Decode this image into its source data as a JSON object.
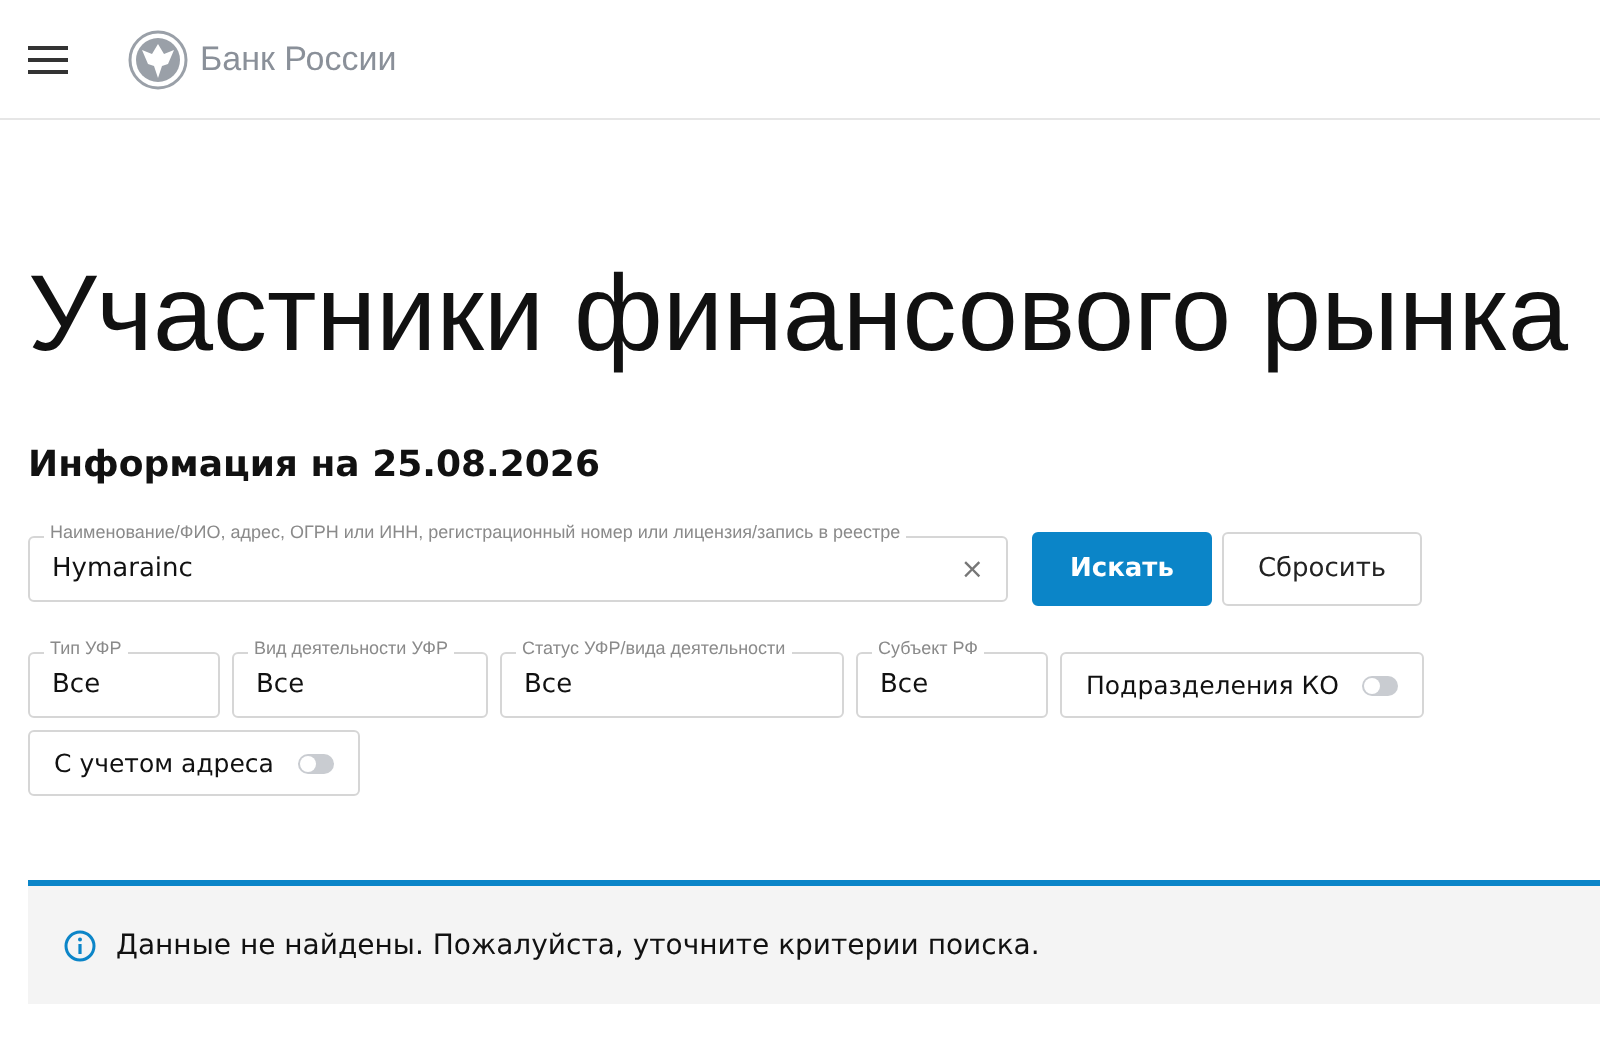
{
  "header": {
    "logo_text": "Банк России"
  },
  "title": "Участники финансового рынка",
  "subtitle": "Информация на 25.08.2026",
  "search": {
    "label": "Наименование/ФИО, адрес, ОГРН или ИНН, регистрационный номер или лицензия/запись в реестре",
    "value": "Hymarainc",
    "clear": "×"
  },
  "buttons": [
    {
      "label": "Искать",
      "kind": "primary"
    },
    {
      "label": "Сбросить",
      "kind": "secondary"
    }
  ],
  "filters": [
    {
      "kind": "select",
      "label": "Тип УФР",
      "value": "Все"
    },
    {
      "kind": "select",
      "label": "Вид деятельности УФР",
      "value": "Все"
    },
    {
      "kind": "select",
      "label": "Статус УФР/вида деятельности",
      "value": "Все"
    },
    {
      "kind": "select",
      "label": "Субъект РФ",
      "value": "Все"
    },
    {
      "kind": "toggle",
      "label": "Подразделения КО",
      "on": false
    },
    {
      "kind": "toggle",
      "label": "С учетом адреса",
      "on": false
    }
  ],
  "alert": {
    "message": "Данные не найдены. Пожалуйста, уточните критерии поиска."
  }
}
